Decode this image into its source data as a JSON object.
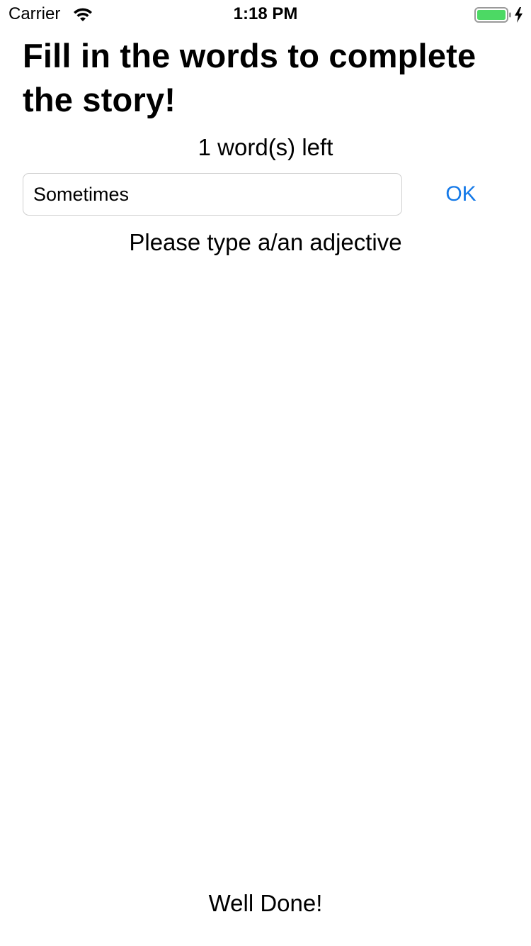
{
  "status_bar": {
    "carrier": "Carrier",
    "time": "1:18 PM",
    "wifi_icon": "wifi-icon",
    "battery_icon": "battery-charging-icon",
    "battery_level": 1.0,
    "battery_color": "#4cd964"
  },
  "main": {
    "title": "Fill in the words to complete the story!",
    "words_left": "1 word(s) left",
    "input_value": "Sometimes",
    "ok_label": "OK",
    "prompt": "Please type a/an adjective",
    "footer": "Well Done!"
  },
  "colors": {
    "accent": "#1479e8",
    "text": "#000000",
    "background": "#ffffff"
  }
}
